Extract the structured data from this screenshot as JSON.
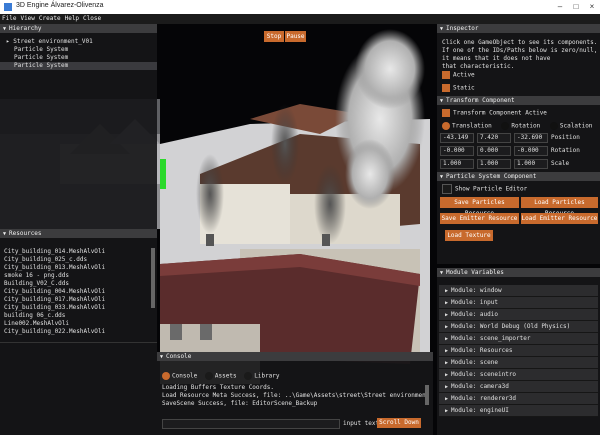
{
  "window": {
    "title": "3D Engine Álvarez-Olivenza"
  },
  "menu": [
    "File",
    "View",
    "Create",
    "Help",
    "Close"
  ],
  "playback": {
    "stop": "Stop",
    "pause": "Pause"
  },
  "hierarchy": {
    "title": "Hierarchy",
    "root": "Street environment_V01",
    "items": [
      "Particle System",
      "Particle System",
      "Particle System"
    ]
  },
  "resources": {
    "title": "Resources",
    "items": [
      "City_building_014.MeshAlvOli",
      "City_building_025_c.dds",
      "City_building_013.MeshAlvOli",
      "smoke 16 - png.dds",
      "Building_V02_C.dds",
      "City_building_004.MeshAlvOli",
      "City_building_017.MeshAlvOli",
      "City_building_033.MeshAlvOli",
      "building 06_c.dds",
      "Line002.MeshAlvOli",
      "City_building_022.MeshAlvOli"
    ]
  },
  "console": {
    "title": "Console",
    "tabs": [
      "Console",
      "Assets",
      "Library"
    ],
    "lines": [
      "Loading Buffers Texture Coords.",
      "Load Resource Meta Success, file: ..\\Game\\Assets\\street\\Street environment_V01.i",
      "SaveScene Success, file: EditorScene_Backup"
    ],
    "input_label": "input text",
    "scroll_down": "Scroll Down"
  },
  "inspector": {
    "title": "Inspector",
    "help": [
      "Click one GameObject to see its components.",
      "If one of the IDs/Paths below is zero/null,",
      "it means that it does not have",
      "that characteristic."
    ],
    "active": "Active",
    "static": "Static",
    "transform": {
      "title": "Transform Component",
      "active_label": "Transform Component Active",
      "modes": [
        "Translation",
        "Rotation",
        "Scalation"
      ],
      "rows": [
        {
          "values": [
            "-43.149",
            "7.420",
            "-32.690"
          ],
          "label": "Position"
        },
        {
          "values": [
            "-0.000",
            "0.000",
            "-0.000"
          ],
          "label": "Rotation"
        },
        {
          "values": [
            "1.000",
            "1.000",
            "1.000"
          ],
          "label": "Scale"
        }
      ]
    },
    "particle": {
      "title": "Particle System Component",
      "show_editor": "Show Particle Editor",
      "buttons": [
        "Save Particles Resource",
        "Load Particles Resource",
        "Save Emitter Resource",
        "Load Emitter Resource",
        "Load Texture"
      ]
    }
  },
  "module_vars": {
    "title": "Module Variables",
    "items": [
      "Module: window",
      "Module: input",
      "Module: audio",
      "Module: World Debug (Old Physics)",
      "Module: scene_importer",
      "Module: Resources",
      "Module: scene",
      "Module: sceneintro",
      "Module: camera3d",
      "Module: renderer3d",
      "Module: engineUI"
    ]
  },
  "colors": {
    "accent": "#c86a2d",
    "panel_header": "#3c3c3e",
    "panel_bg": "#161618"
  }
}
